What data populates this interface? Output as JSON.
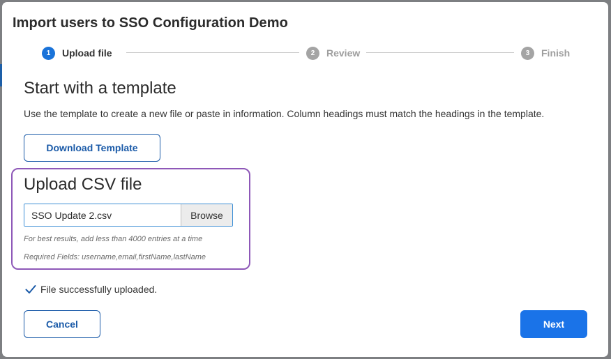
{
  "modal": {
    "title": "Import users to SSO Configuration Demo"
  },
  "stepper": {
    "steps": [
      {
        "number": "1",
        "label": "Upload file",
        "state": "active"
      },
      {
        "number": "2",
        "label": "Review",
        "state": "inactive"
      },
      {
        "number": "3",
        "label": "Finish",
        "state": "inactive"
      }
    ]
  },
  "template_section": {
    "heading": "Start with a template",
    "description": "Use the template to create a new file or paste in information. Column headings must match the headings in the template.",
    "download_label": "Download Template"
  },
  "upload_section": {
    "heading": "Upload CSV file",
    "file_value": "SSO Update 2.csv",
    "browse_label": "Browse",
    "hint_entries": "For best results, add less than 4000 entries at a time",
    "hint_required": "Required Fields: username,email,firstName,lastName"
  },
  "status": {
    "icon": "checkmark-icon",
    "message": "File successfully uploaded."
  },
  "footer": {
    "cancel_label": "Cancel",
    "next_label": "Next"
  },
  "colors": {
    "primary": "#1a73e8",
    "outline_text": "#1a5aa8",
    "highlight_border": "#8e58b8",
    "step_active": "#1a73d9",
    "step_inactive": "#a4a4a4"
  }
}
